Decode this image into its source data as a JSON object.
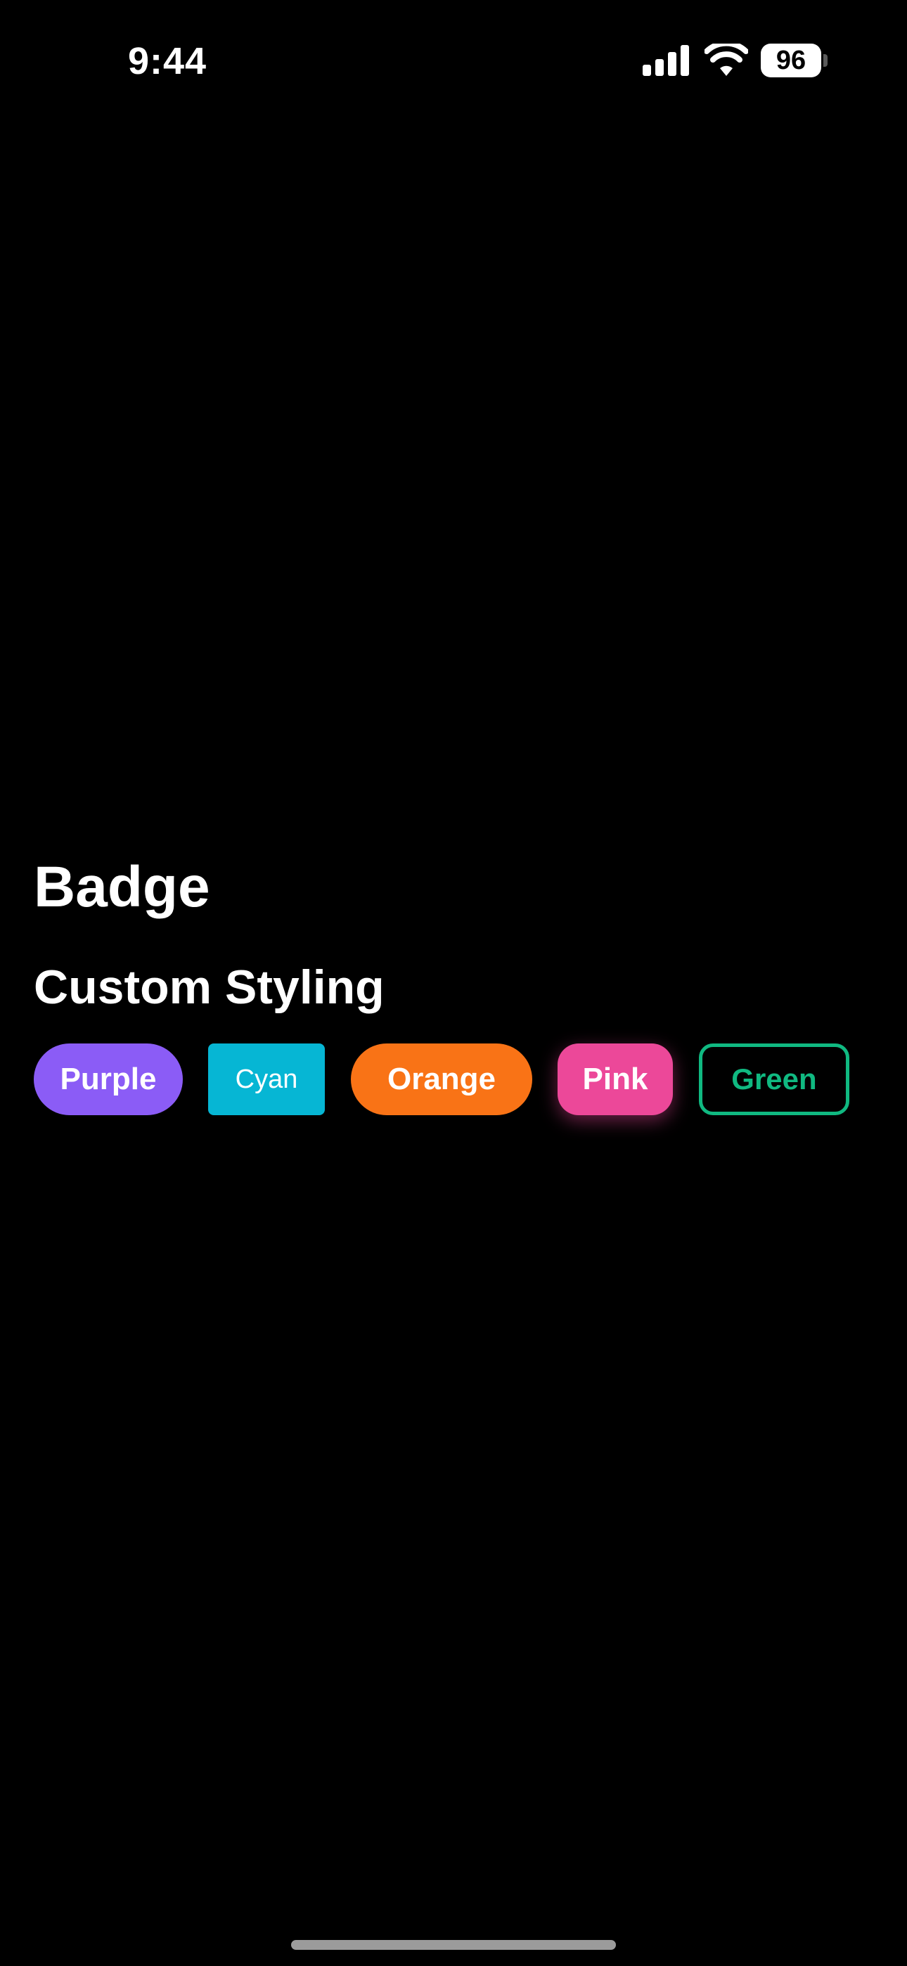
{
  "status_bar": {
    "time": "9:44",
    "battery_level": "96",
    "icons": [
      "signal-icon",
      "wifi-icon",
      "battery-icon"
    ]
  },
  "page": {
    "title": "Badge",
    "section_title": "Custom Styling"
  },
  "badges": [
    {
      "label": "Purple",
      "color": "#8B5CF6",
      "style": "filled-pill"
    },
    {
      "label": "Cyan",
      "color": "#06B6D4",
      "style": "filled-square"
    },
    {
      "label": "Orange",
      "color": "#F97316",
      "style": "filled-pill"
    },
    {
      "label": "Pink",
      "color": "#EC4899",
      "style": "filled-rounded-shadow"
    },
    {
      "label": "Green",
      "color": "#10B981",
      "style": "outline"
    }
  ]
}
